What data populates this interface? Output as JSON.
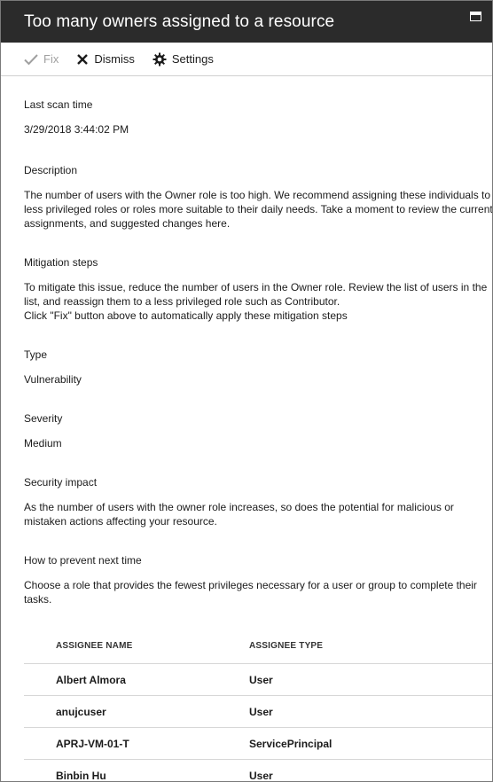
{
  "blade": {
    "title": "Too many owners assigned to a resource"
  },
  "toolbar": {
    "fix_label": "Fix",
    "dismiss_label": "Dismiss",
    "settings_label": "Settings"
  },
  "sections": {
    "last_scan": {
      "label": "Last scan time",
      "value": "3/29/2018 3:44:02 PM"
    },
    "description": {
      "label": "Description",
      "value": "The number of users with the Owner role is too high. We recommend assigning these individuals to less privileged roles or roles more suitable to their daily needs. Take a moment to review the current assignments, and suggested changes here."
    },
    "mitigation": {
      "label": "Mitigation steps",
      "value": "To mitigate this issue, reduce the number of users in the Owner role. Review the list of users in the list, and reassign them to a less privileged role such as Contributor.\nClick \"Fix\" button above to automatically apply these mitigation steps"
    },
    "type": {
      "label": "Type",
      "value": "Vulnerability"
    },
    "severity": {
      "label": "Severity",
      "value": "Medium"
    },
    "impact": {
      "label": "Security impact",
      "value": "As the number of users with the owner role increases, so does the potential for malicious or mistaken actions affecting your resource."
    },
    "prevent": {
      "label": "How to prevent next time",
      "value": "Choose a role that provides the fewest privileges necessary for a user or group to complete their tasks."
    }
  },
  "table": {
    "headers": [
      "ASSIGNEE NAME",
      "ASSIGNEE TYPE"
    ],
    "rows": [
      {
        "name": "Albert Almora",
        "type": "User"
      },
      {
        "name": "anujcuser",
        "type": "User"
      },
      {
        "name": "APRJ-VM-01-T",
        "type": "ServicePrincipal"
      },
      {
        "name": "Binbin Hu",
        "type": "User"
      }
    ]
  }
}
